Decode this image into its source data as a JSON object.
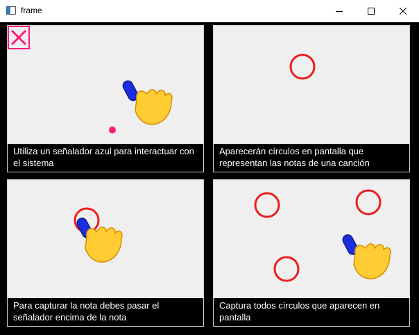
{
  "window": {
    "title": "frame",
    "icons": [
      "app-icon",
      "minimize-icon",
      "maximize-icon",
      "close-icon"
    ]
  },
  "colors": {
    "pointer_blue": "#1a2ee0",
    "ring_red": "#ee1c1c",
    "accent_pink": "#ff1a7a",
    "hand_yellow": "#ffcc33"
  },
  "panels": [
    {
      "caption": "Utiliza un señalador azul para interactuar con el sistema"
    },
    {
      "caption": "Aparecerán círculos en pantalla que representan las notas de una canción"
    },
    {
      "caption": "Para capturar la nota debes pasar el señalador encima de la nota"
    },
    {
      "caption": "Captura todos círculos que aparecen en pantalla"
    }
  ],
  "overlay_icon": "close-x-icon"
}
